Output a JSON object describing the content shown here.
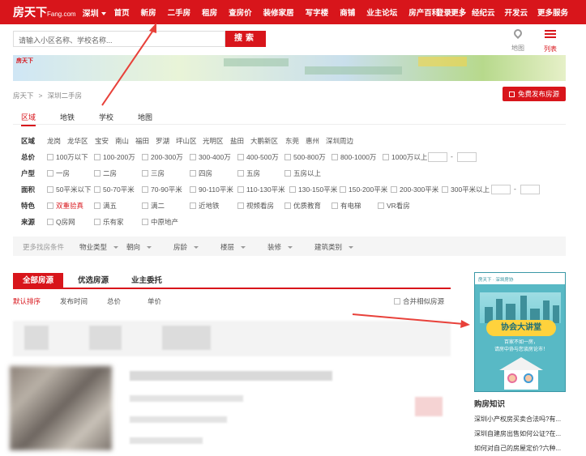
{
  "nav": {
    "logo": "房天下",
    "logo_sub": "Fang.com",
    "city": "深圳",
    "items": [
      "首页",
      "新房",
      "二手房",
      "租房",
      "查房价",
      "装修家居",
      "写字楼",
      "商铺",
      "业主论坛",
      "房产百科",
      "更多"
    ],
    "right_items": [
      "登录",
      "经纪云",
      "开发云",
      "更多服务"
    ]
  },
  "search": {
    "placeholder": "请输入小区名称、学校名称...",
    "button": "搜索",
    "map_label": "地图",
    "list_label": "列表"
  },
  "banner": {
    "logo": "房天下"
  },
  "breadcrumb": {
    "home": "房天下",
    "sep": ">",
    "current": "深圳二手房"
  },
  "post_button": "免费发布房源",
  "tabs": [
    "区域",
    "地铁",
    "学校",
    "地图"
  ],
  "filters": {
    "area": {
      "label": "区域",
      "options": [
        "龙岗",
        "龙华区",
        "宝安",
        "南山",
        "福田",
        "罗湖",
        "坪山区",
        "光明区",
        "盐田",
        "大鹏新区",
        "东莞",
        "惠州",
        "深圳周边"
      ]
    },
    "price": {
      "label": "总价",
      "options": [
        "100万以下",
        "100-200万",
        "200-300万",
        "300-400万",
        "400-500万",
        "500-800万",
        "800-1000万",
        "1000万以上"
      ],
      "dash": "-"
    },
    "layout": {
      "label": "户型",
      "options": [
        "一房",
        "二房",
        "三房",
        "四房",
        "五房",
        "五房以上"
      ]
    },
    "size": {
      "label": "面积",
      "options": [
        "50平米以下",
        "50-70平米",
        "70-90平米",
        "90-110平米",
        "110-130平米",
        "130-150平米",
        "150-200平米",
        "200-300平米",
        "300平米以上"
      ],
      "dash": "-"
    },
    "feature": {
      "label": "特色",
      "options": [
        "双重验真",
        "满五",
        "满二",
        "近地铁",
        "视频看房",
        "优质教育",
        "有电梯",
        "VR看房"
      ]
    },
    "source": {
      "label": "来源",
      "options": [
        "Q房网",
        "乐有家",
        "中原地产"
      ]
    }
  },
  "more_filters": {
    "label": "更多找房条件",
    "options": [
      "物业类型",
      "朝向",
      "房龄",
      "楼层",
      "装修",
      "建筑类别"
    ]
  },
  "list_tabs": [
    "全部房源",
    "优选房源",
    "业主委托"
  ],
  "sort": {
    "items": [
      "默认排序",
      "发布时间",
      "总价",
      "单价"
    ],
    "merge": "合并相似房源"
  },
  "ad": {
    "top": "房天下 · 深圳房协",
    "title": "协会大讲堂",
    "sub1": "百家不如一房，",
    "sub2": "请房中协与您谈房论市！"
  },
  "knowledge": {
    "title": "购房知识",
    "items": [
      "深圳小产权房买卖合法吗?有...",
      "深圳自建房出售如何公证?在...",
      "如何对自己的房屋定价?六种..."
    ]
  },
  "colors": {
    "brand_red": "#d8151b",
    "arrow_red": "#e8413a",
    "ad_teal": "#58b9c5"
  }
}
